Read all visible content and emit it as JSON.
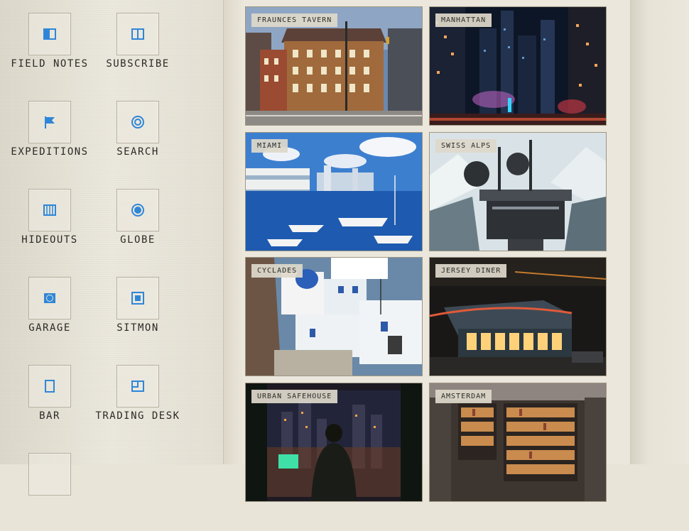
{
  "sidebar": {
    "items": [
      {
        "label": "FIELD NOTES",
        "icon": "book-icon"
      },
      {
        "label": "SUBSCRIBE",
        "icon": "panels-icon"
      },
      {
        "label": "EXPEDITIONS",
        "icon": "flag-icon"
      },
      {
        "label": "SEARCH",
        "icon": "target-icon"
      },
      {
        "label": "HIDEOUTS",
        "icon": "grid-icon"
      },
      {
        "label": "GLOBE",
        "icon": "globe-icon"
      },
      {
        "label": "GARAGE",
        "icon": "wheel-icon"
      },
      {
        "label": "SITMON",
        "icon": "monitor-icon"
      },
      {
        "label": "BAR",
        "icon": "glass-icon"
      },
      {
        "label": "TRADING DESK",
        "icon": "chart-window-icon"
      }
    ]
  },
  "gallery": {
    "cards": [
      {
        "label": "FRAUNCES TAVERN"
      },
      {
        "label": "MANHATTAN"
      },
      {
        "label": "MIAMI"
      },
      {
        "label": "SWISS ALPS"
      },
      {
        "label": "CYCLADES"
      },
      {
        "label": "JERSEY DINER"
      },
      {
        "label": "URBAN SAFEHOUSE"
      },
      {
        "label": "AMSTERDAM"
      }
    ]
  },
  "colors": {
    "accent": "#2f86d8",
    "background": "#e8e4d8",
    "border": "#b5ae9b"
  }
}
